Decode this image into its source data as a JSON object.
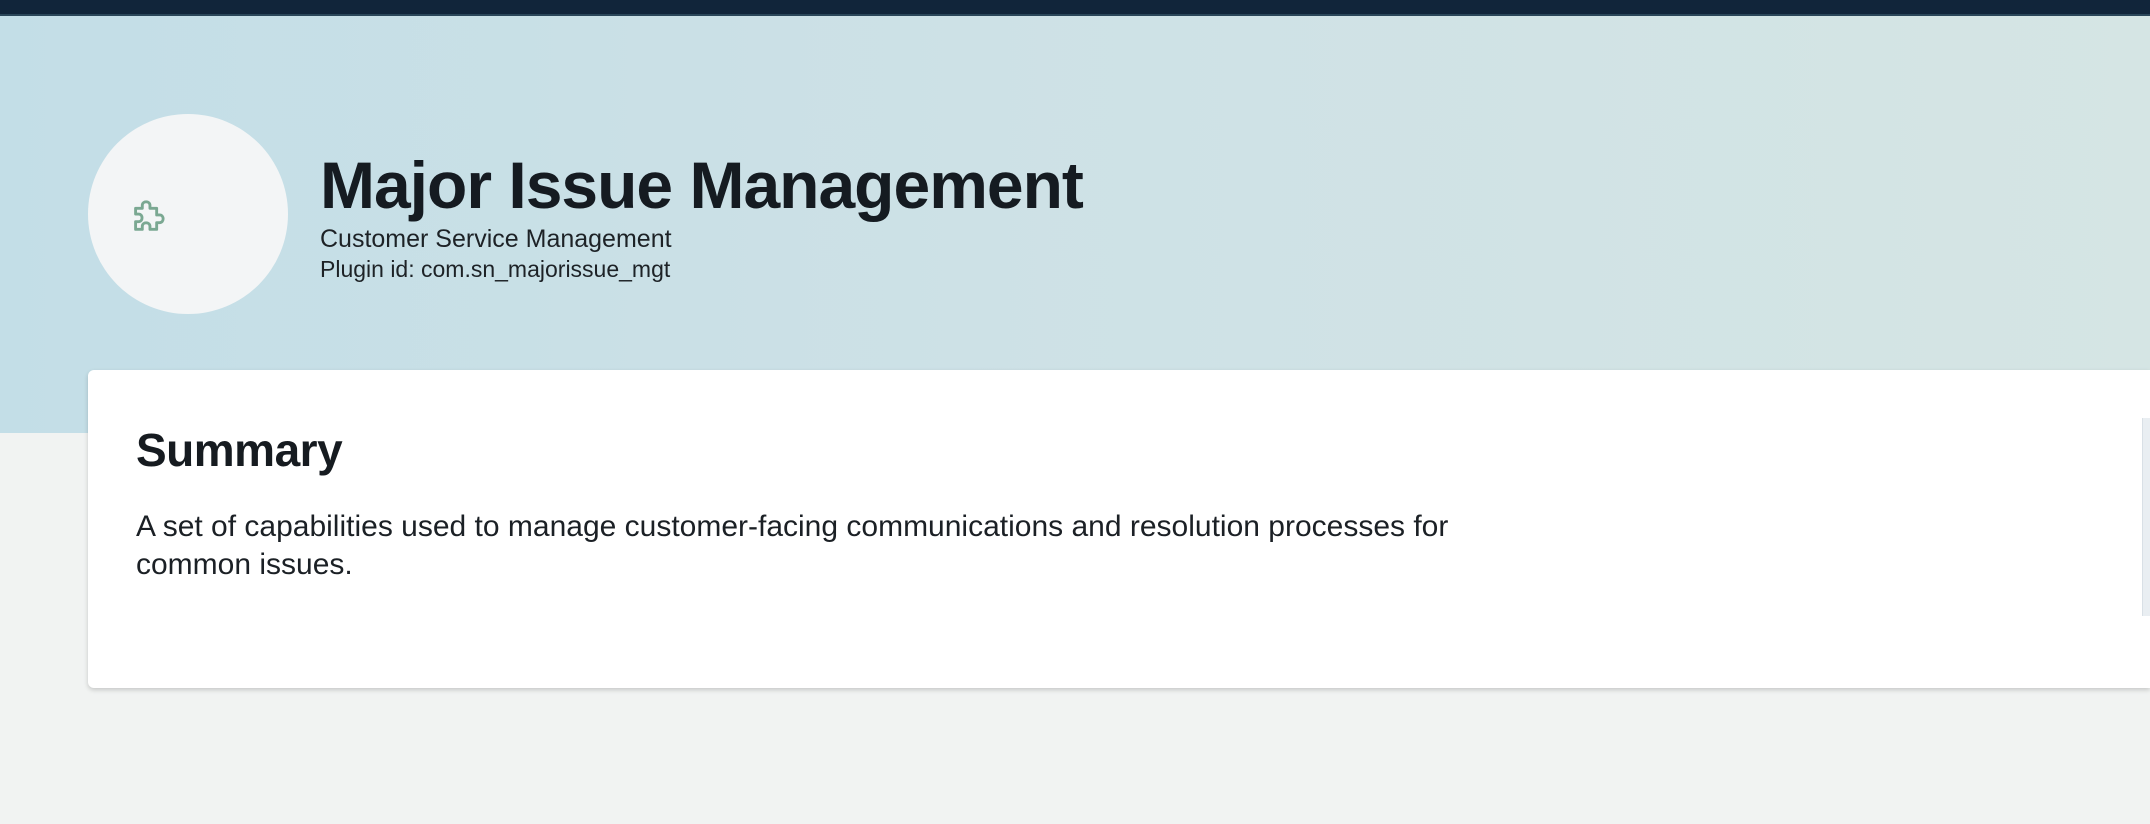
{
  "header": {
    "title": "Major Issue Management",
    "product": "Customer Service Management",
    "plugin_id": "Plugin id: com.sn_majorissue_mgt",
    "icon": "puzzle-piece-icon",
    "icon_color": "#7aa892"
  },
  "summary": {
    "title": "Summary",
    "description": "A set of capabilities used to manage customer-facing communications and resolution processes for common issues."
  },
  "colors": {
    "top_bar": "#11253a",
    "hero_background_start": "#c3dee7",
    "hero_background_end": "#d5e5e4",
    "page_background": "#f1f3f2",
    "card_background": "#ffffff",
    "text": "#161b20"
  }
}
